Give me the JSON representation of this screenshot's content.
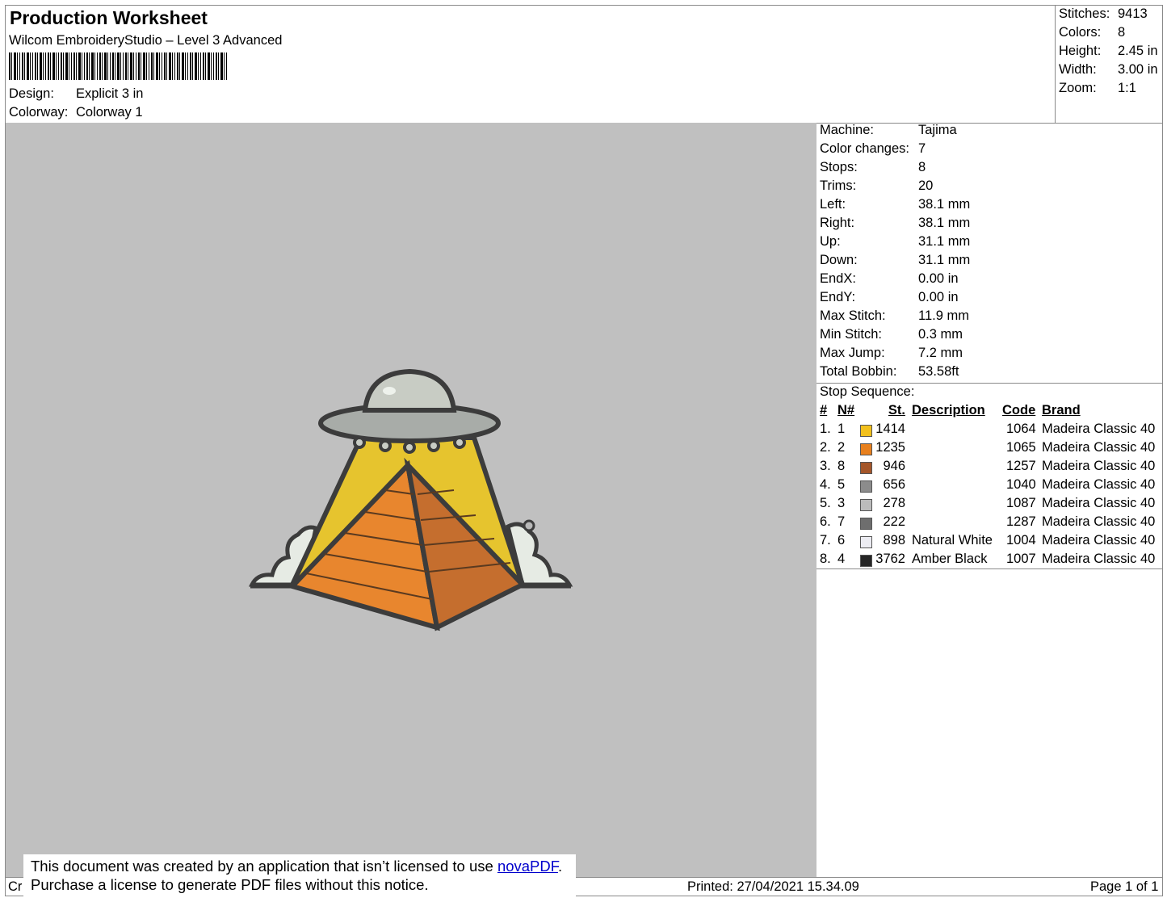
{
  "header": {
    "title": "Production Worksheet",
    "software": "Wilcom EmbroideryStudio – Level 3 Advanced",
    "design_label": "Design:",
    "design_value": "Explicit 3 in",
    "colorway_label": "Colorway:",
    "colorway_value": "Colorway 1"
  },
  "summary": [
    {
      "label": "Stitches:",
      "value": "9413"
    },
    {
      "label": "Colors:",
      "value": "8"
    },
    {
      "label": "Height:",
      "value": "2.45 in"
    },
    {
      "label": "Width:",
      "value": "3.00 in"
    },
    {
      "label": "Zoom:",
      "value": "1:1"
    }
  ],
  "details": [
    {
      "label": "Machine:",
      "value": "Tajima"
    },
    {
      "label": "Color changes:",
      "value": "7"
    },
    {
      "label": "Stops:",
      "value": "8"
    },
    {
      "label": "Trims:",
      "value": "20"
    },
    {
      "label": "Left:",
      "value": "38.1 mm"
    },
    {
      "label": "Right:",
      "value": "38.1 mm"
    },
    {
      "label": "Up:",
      "value": "31.1 mm"
    },
    {
      "label": "Down:",
      "value": "31.1 mm"
    },
    {
      "label": "EndX:",
      "value": "0.00 in"
    },
    {
      "label": "EndY:",
      "value": "0.00 in"
    },
    {
      "label": "Max Stitch:",
      "value": "11.9 mm"
    },
    {
      "label": "Min Stitch:",
      "value": "0.3 mm"
    },
    {
      "label": "Max Jump:",
      "value": "7.2 mm"
    },
    {
      "label": "Total Bobbin:",
      "value": "53.58ft"
    }
  ],
  "stop_sequence": {
    "title": "Stop Sequence:",
    "headers": {
      "num": "#",
      "n": "N#",
      "st": "St.",
      "description": "Description",
      "code": "Code",
      "brand": "Brand"
    },
    "rows": [
      {
        "num": "1.",
        "n": "1",
        "color": "#f2c01c",
        "st": "1414",
        "description": "",
        "code": "1064",
        "brand": "Madeira Classic 40"
      },
      {
        "num": "2.",
        "n": "2",
        "color": "#e8801e",
        "st": "1235",
        "description": "",
        "code": "1065",
        "brand": "Madeira Classic 40"
      },
      {
        "num": "3.",
        "n": "8",
        "color": "#a4562a",
        "st": "946",
        "description": "",
        "code": "1257",
        "brand": "Madeira Classic 40"
      },
      {
        "num": "4.",
        "n": "5",
        "color": "#8c8c8c",
        "st": "656",
        "description": "",
        "code": "1040",
        "brand": "Madeira Classic 40"
      },
      {
        "num": "5.",
        "n": "3",
        "color": "#bcbcbc",
        "st": "278",
        "description": "",
        "code": "1087",
        "brand": "Madeira Classic 40"
      },
      {
        "num": "6.",
        "n": "7",
        "color": "#6e6e6e",
        "st": "222",
        "description": "",
        "code": "1287",
        "brand": "Madeira Classic 40"
      },
      {
        "num": "7.",
        "n": "6",
        "color": "#ececf2",
        "st": "898",
        "description": "Natural White",
        "code": "1004",
        "brand": "Madeira Classic 40"
      },
      {
        "num": "8.",
        "n": "4",
        "color": "#262626",
        "st": "3762",
        "description": "Amber Black",
        "code": "1007",
        "brand": "Madeira Classic 40"
      }
    ]
  },
  "footer": {
    "left": "Cr",
    "printed": "Printed: 27/04/2021 15.34.09",
    "page": "Page 1 of 1"
  },
  "notice": {
    "line1": "This document was created by an application that isn’t licensed to use ",
    "link": "novaPDF",
    "line1_end": ".",
    "line2": "Purchase a license to generate PDF files without this notice."
  },
  "colors": {
    "canvas": "#c0c0c0",
    "link": "#0000cc"
  }
}
